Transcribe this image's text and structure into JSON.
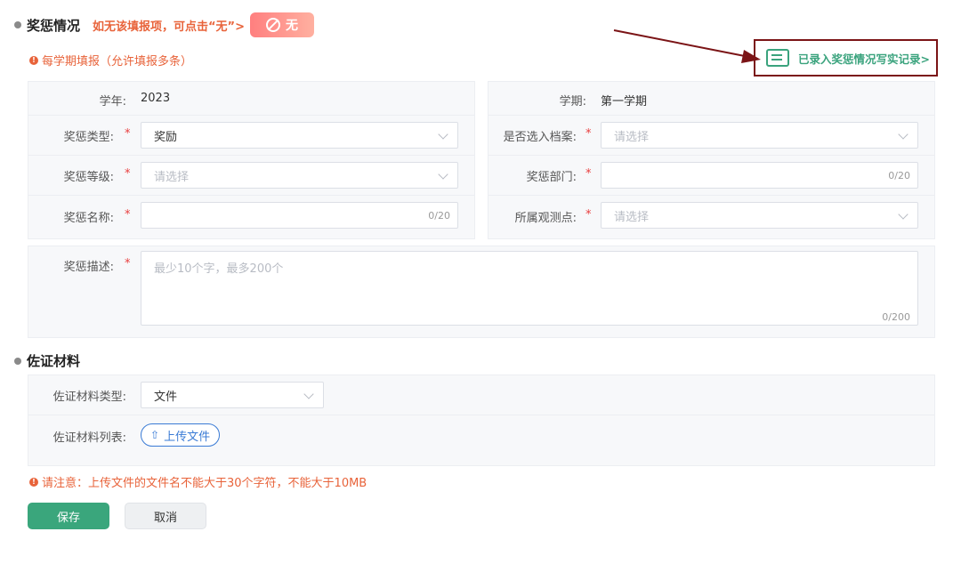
{
  "awards": {
    "title": "奖惩情况",
    "hint": "如无该填报项，可点击“无”>",
    "none_button": "无",
    "notice": "每学期填报（允许填报多条）",
    "record_link": "已录入奖惩情况写实记录>",
    "year_label": "学年:",
    "year_value": "2023",
    "term_label": "学期:",
    "term_value": "第一学期",
    "type_label": "奖惩类型:",
    "type_value": "奖励",
    "archive_label": "是否选入档案:",
    "archive_placeholder": "请选择",
    "level_label": "奖惩等级:",
    "level_placeholder": "请选择",
    "dept_label": "奖惩部门:",
    "dept_counter": "0/20",
    "name_label": "奖惩名称:",
    "name_counter": "0/20",
    "point_label": "所属观测点:",
    "point_placeholder": "请选择",
    "desc_label": "奖惩描述:",
    "desc_placeholder": "最少10个字，最多200个",
    "desc_counter": "0/200",
    "required_mark": "*"
  },
  "evidence": {
    "title": "佐证材料",
    "type_label": "佐证材料类型:",
    "type_value": "文件",
    "list_label": "佐证材料列表:",
    "upload_label": "上传文件",
    "notice": "请注意：上传文件的文件名不能大于30个字符，不能大于10MB"
  },
  "actions": {
    "save": "保存",
    "cancel": "取消"
  },
  "colors": {
    "accent_green": "#3aa67c",
    "warning_orange": "#e8633a",
    "highlight_box": "#7b1416"
  }
}
